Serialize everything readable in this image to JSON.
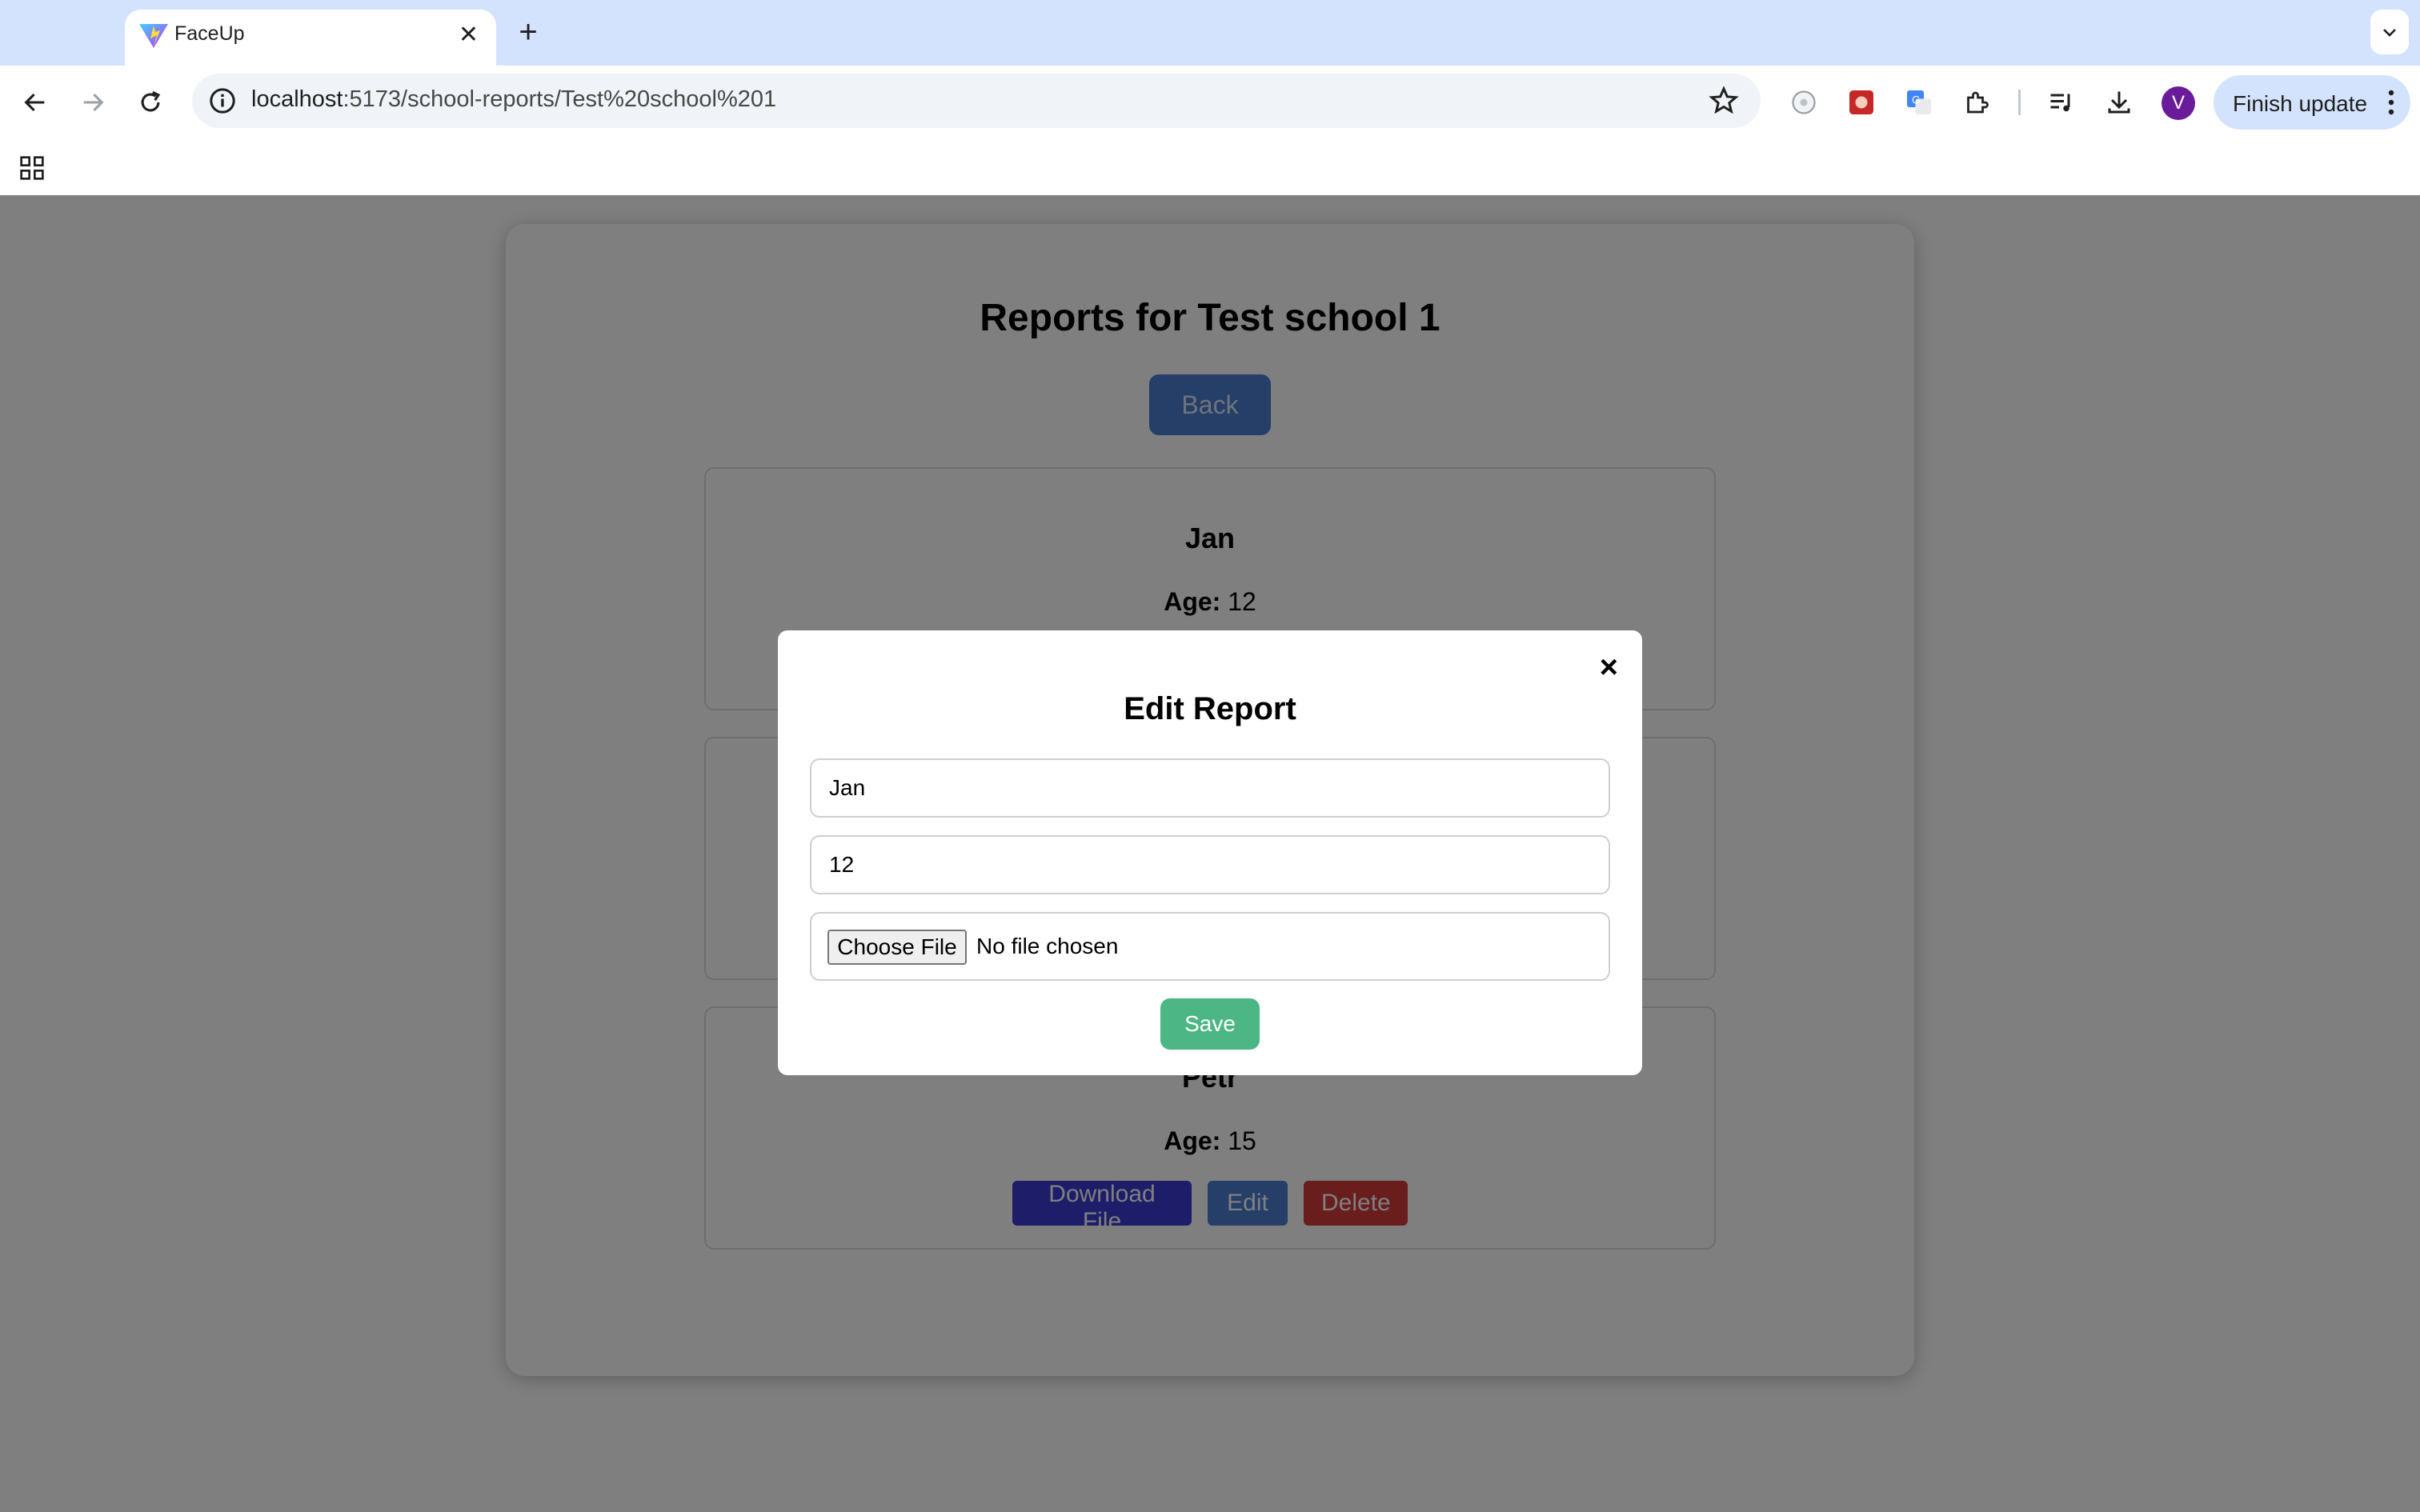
{
  "browser": {
    "tab_title": "FaceUp",
    "url_host": "localhost",
    "url_path": ":5173/school-reports/Test%20school%201",
    "avatar_letter": "V",
    "update_label": "Finish update",
    "icons": [
      "back-arrow-icon",
      "forward-arrow-icon",
      "reload-icon",
      "site-info-icon",
      "star-icon",
      "extension-icon",
      "puzzle-icon",
      "media-icon",
      "download-icon",
      "apps-grid-icon"
    ]
  },
  "page": {
    "title": "Reports for Test school 1",
    "back_label": "Back",
    "age_label": "Age:",
    "download_label": "Download File",
    "edit_label": "Edit",
    "delete_label": "Delete",
    "reports": [
      {
        "name": "Jan",
        "age": "12"
      },
      {
        "name": "",
        "age": ""
      },
      {
        "name": "Petr",
        "age": "15"
      }
    ]
  },
  "modal": {
    "title": "Edit Report",
    "close_symbol": "×",
    "name_value": "Jan",
    "age_value": "12",
    "choose_file_label": "Choose File",
    "file_status": "No file chosen",
    "save_label": "Save"
  },
  "colors": {
    "back_button": "#4a7fd3",
    "download_button": "#3b3bd4",
    "edit_button": "#4a7fd3",
    "delete_button": "#d43b3b",
    "save_button": "#4cb684",
    "tab_strip": "#d3e3fd"
  }
}
